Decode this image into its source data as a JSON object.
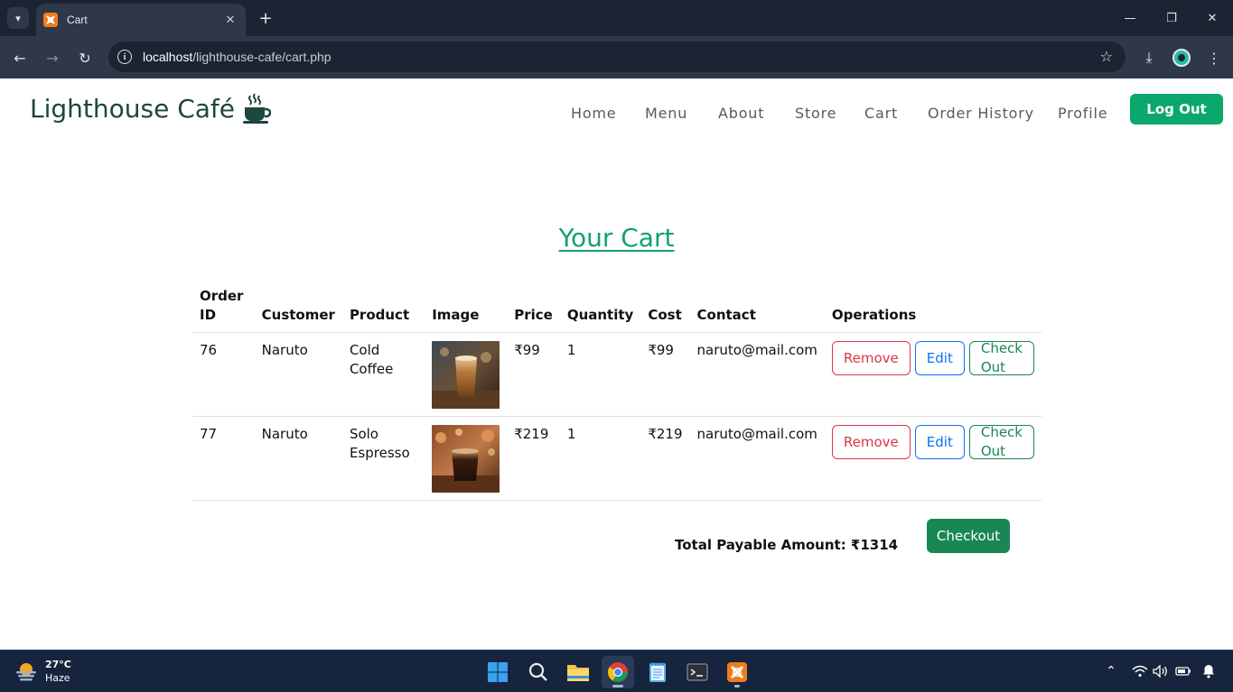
{
  "browser": {
    "tab_title": "Cart",
    "url_host": "localhost",
    "url_path": "/lighthouse-cafe/cart.php"
  },
  "site": {
    "brand": "Lighthouse Café",
    "nav": [
      "Home",
      "Menu",
      "About",
      "Store",
      "Cart",
      "Order History",
      "Profile"
    ],
    "logout_label": "Log Out",
    "accent_color": "#0aa86a"
  },
  "cart": {
    "title": "Your Cart",
    "headers": [
      "Order ID",
      "Customer",
      "Product",
      "Image",
      "Price",
      "Quantity",
      "Cost",
      "Contact",
      "Operations"
    ],
    "rows": [
      {
        "order_id": "76",
        "customer": "Naruto",
        "product": "Cold Coffee",
        "image": "cold-coffee-photo",
        "price": "₹99",
        "quantity": "1",
        "cost": "₹99",
        "contact": "naruto@mail.com"
      },
      {
        "order_id": "77",
        "customer": "Naruto",
        "product": "Solo Espresso",
        "image": "solo-espresso-photo",
        "price": "₹219",
        "quantity": "1",
        "cost": "₹219",
        "contact": "naruto@mail.com"
      }
    ],
    "operations": {
      "remove": "Remove",
      "edit": "Edit",
      "checkout": "Check Out"
    },
    "total_label": "Total Payable Amount: ₹1314",
    "checkout_button": "Checkout"
  },
  "taskbar": {
    "temperature": "27°C",
    "condition": "Haze",
    "apps": [
      "windows-start-icon",
      "search-icon",
      "file-explorer-icon",
      "chrome-icon",
      "notepad-icon",
      "terminal-icon",
      "xampp-icon"
    ]
  }
}
